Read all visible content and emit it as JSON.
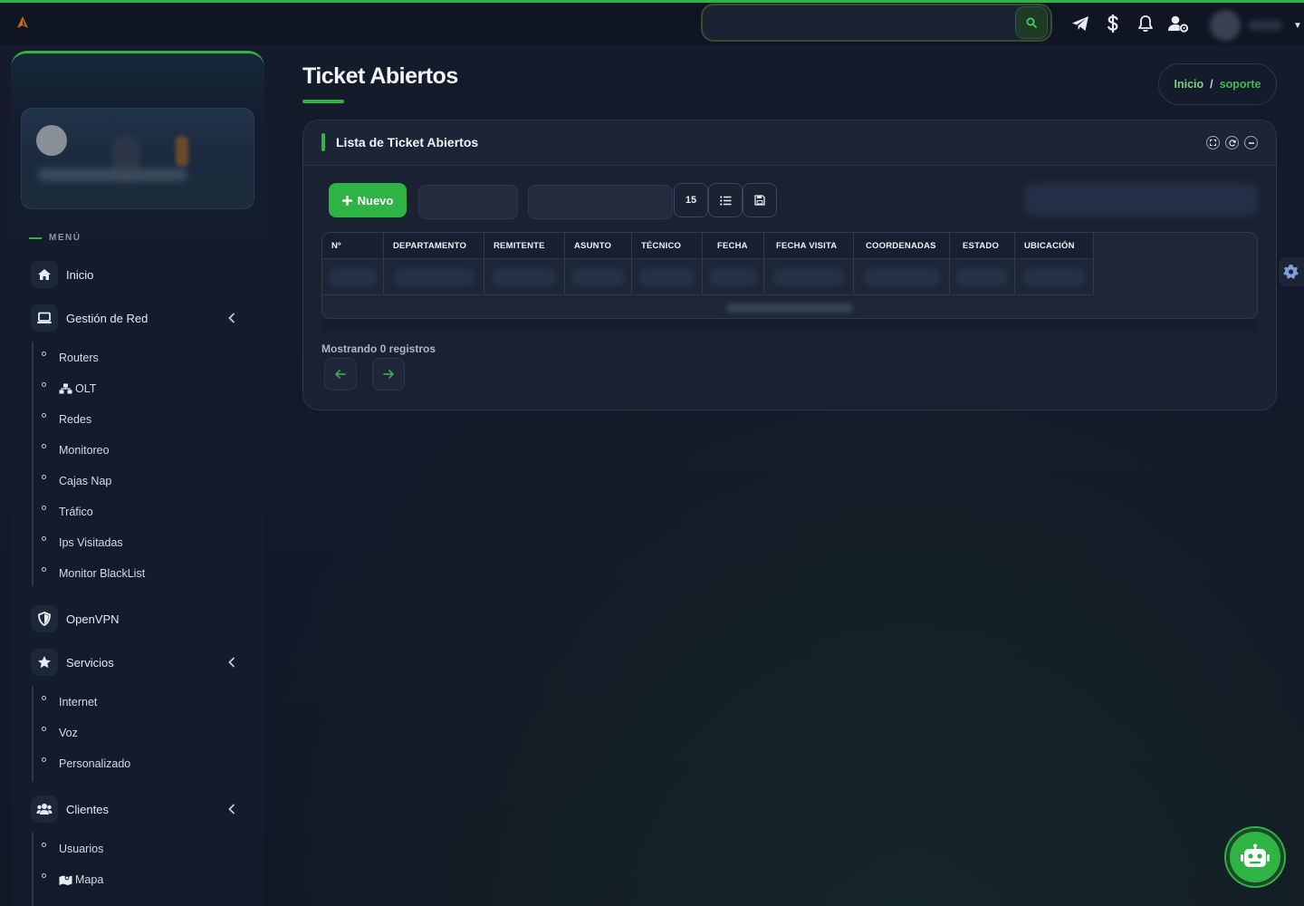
{
  "navbar": {
    "search_placeholder": "",
    "icons": [
      "telegram-icon",
      "dollar-icon",
      "bell-icon",
      "user-cog-icon"
    ]
  },
  "sidebar": {
    "menu_label": "MENÚ",
    "items": [
      {
        "label": "Inicio",
        "icon": "home-icon"
      },
      {
        "label": "Gestión de Red",
        "icon": "laptop-icon"
      },
      {
        "label": "OpenVPN",
        "icon": "shield-icon"
      },
      {
        "label": "Servicios",
        "icon": "star-icon"
      },
      {
        "label": "Clientes",
        "icon": "users-icon"
      }
    ],
    "red_sub": [
      "Routers",
      "OLT",
      "Redes",
      "Monitoreo",
      "Cajas Nap",
      "Tráfico",
      "Ips Visitadas",
      "Monitor BlackList"
    ],
    "servicios_sub": [
      "Internet",
      "Voz",
      "Personalizado"
    ],
    "clientes_sub": [
      "Usuarios",
      "Mapa"
    ]
  },
  "page": {
    "title": "Ticket Abiertos",
    "breadcrumb": {
      "home": "Inicio",
      "separator": "/",
      "current": "soporte"
    }
  },
  "card": {
    "title": "Lista de Ticket Abiertos",
    "new_button": "Nuevo",
    "page_length": "15",
    "columns": [
      "Nº",
      "DEPARTAMENTO",
      "REMITENTE",
      "ASUNTO",
      "TÉCNICO",
      "FECHA",
      "FECHA VISITA",
      "COORDENADAS",
      "ESTADO",
      "UBICACIÓN"
    ],
    "showing": "Mostrando 0 registros"
  },
  "colors": {
    "accent": "#2fb344",
    "background": "#121826",
    "card": "#1a2232"
  }
}
